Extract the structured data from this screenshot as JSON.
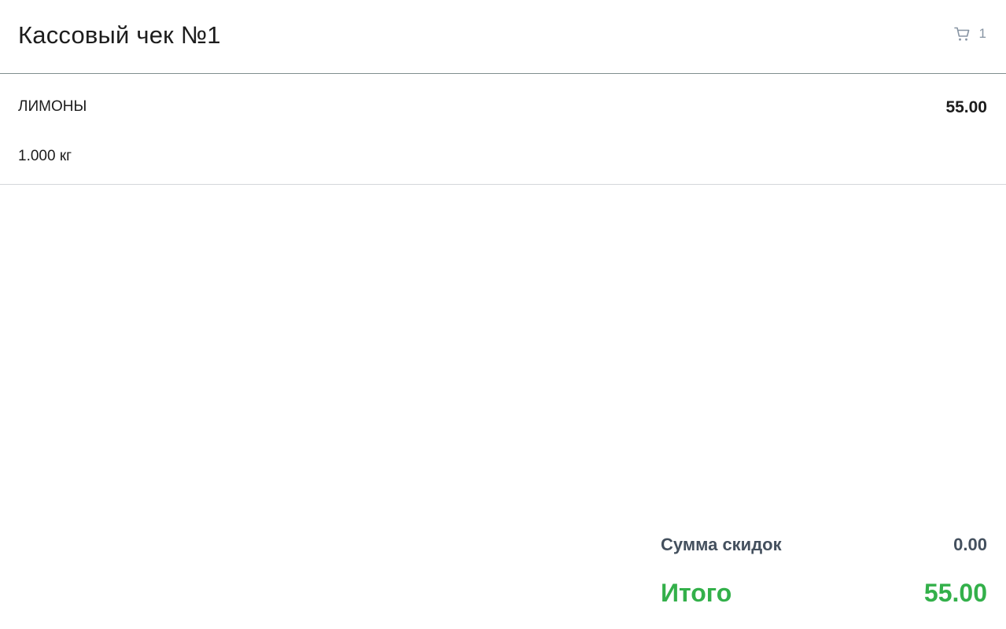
{
  "header": {
    "title": "Кассовый чек №1",
    "cart_icon": "cart-icon",
    "cart_count": "1"
  },
  "items": [
    {
      "name": "ЛИМОНЫ",
      "price": "55.00",
      "quantity": "1.000 кг"
    }
  ],
  "totals": {
    "discount_label": "Сумма скидок",
    "discount_value": "0.00",
    "total_label": "Итого",
    "total_value": "55.00"
  },
  "colors": {
    "total": "#33b04a",
    "discount": "#44505e",
    "cart": "#8794a3"
  }
}
